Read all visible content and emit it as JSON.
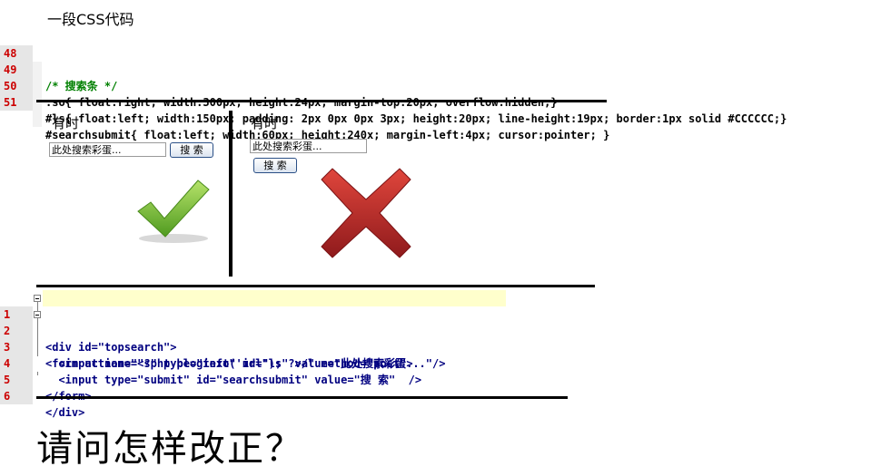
{
  "title": "一段CSS代码",
  "css_lines": [
    {
      "num": "48",
      "text": "/* 搜索条 */"
    },
    {
      "num": "49",
      "text": ".so{ float:right; width:300px; height:24px; margin-top:20px; overflow:hidden;}"
    },
    {
      "num": "50",
      "text": "#ls{ float:left; width:150px; padding: 2px 0px 0px 3px; height:20px; line-height:19px; border:1px solid #CCCCCC;}"
    },
    {
      "num": "51",
      "text": "#searchsubmit{ float:left; width:60px; height:240x; margin-left:4px; cursor:pointer; }"
    }
  ],
  "left_panel": {
    "label": "有时",
    "input_value": "此处搜索彩蛋...",
    "button_label": "搜 索",
    "result": "check-icon"
  },
  "right_panel": {
    "label": "有时",
    "input_value": "此处搜索彩蛋...",
    "button_label": "搜 索",
    "result": "cross-icon"
  },
  "html_lines": [
    {
      "num": "1",
      "text": "<div id=\"topsearch\">"
    },
    {
      "num": "2",
      "text": "<form action=\"<?php bloginfo('url'); ?>/\" method=\"post\">"
    },
    {
      "num": "3",
      "text": "  <input name=\"s\" type=\"text\" id=\"ls\" value=\"此处搜索彩蛋...\"/>"
    },
    {
      "num": "4",
      "text": "  <input type=\"submit\" id=\"searchsubmit\" value=\"搜 索\"  />"
    },
    {
      "num": "5",
      "text": "</form>"
    },
    {
      "num": "6",
      "text": "</div>"
    }
  ],
  "question": "请问怎样改正？",
  "colors": {
    "line_number": "#cc0000",
    "css_property": "#ff6600",
    "comment": "#008000",
    "html_tag": "#000080",
    "html_attr": "#cc0000",
    "html_string": "#3366cc",
    "check_green": "#7ac943",
    "cross_red": "#c1272d"
  }
}
